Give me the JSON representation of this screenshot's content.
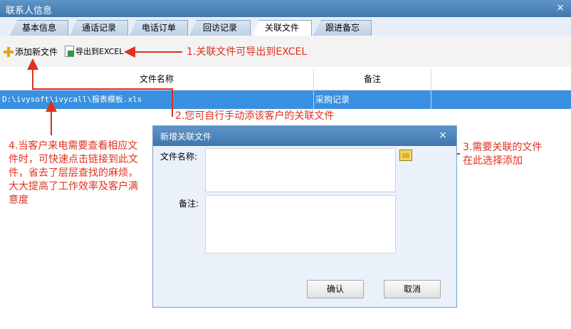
{
  "window": {
    "title": "联系人信息",
    "close_symbol": "×"
  },
  "tabs": [
    {
      "label": "基本信息"
    },
    {
      "label": "通话记录"
    },
    {
      "label": "电话订单"
    },
    {
      "label": "回访记录"
    },
    {
      "label": "关联文件"
    },
    {
      "label": "跟进备忘"
    }
  ],
  "toolbar": {
    "add_label": "添加新文件",
    "export_label": "导出到EXCEL"
  },
  "grid": {
    "columns": [
      "文件名称",
      "备注"
    ],
    "rows": [
      {
        "file": "D:\\ivysoft\\ivycall\\报表模板.xls",
        "note": "采购记录"
      }
    ]
  },
  "annotations": {
    "a1": "1.关联文件可导出到EXCEL",
    "a2": "2.您可自行手动添该客户的关联文件",
    "a3": "3.需要关联的文件在此选择添加",
    "a4": "4.当客户来电需要查看相应文件时，可快速点击链接到此文件，省去了层层查找的麻烦，大大提高了工作效率及客户满意度"
  },
  "dialog": {
    "title": "新增关联文件",
    "close_symbol": "×",
    "file_label": "文件名称:",
    "note_label": "备注:",
    "confirm": "确认",
    "cancel": "取消"
  },
  "colors": {
    "annotation": "#e0301e",
    "selection": "#3a90e0",
    "titlebar": "#4a82b8"
  }
}
